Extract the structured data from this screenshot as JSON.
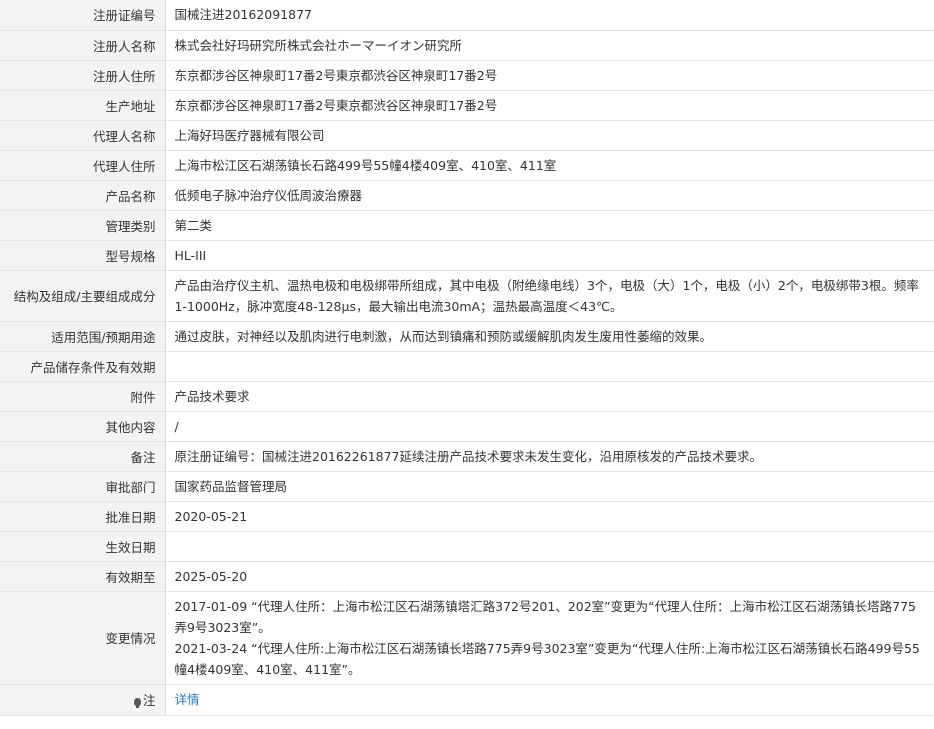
{
  "rows": [
    {
      "label": "注册证编号",
      "value": "国械注进20162091877"
    },
    {
      "label": "注册人名称",
      "value": "株式会社好玛研究所株式会社ホーマーイオン研究所"
    },
    {
      "label": "注册人住所",
      "value": "东京都涉谷区神泉町17番2号東京都渋谷区神泉町17番2号"
    },
    {
      "label": "生产地址",
      "value": "东京都涉谷区神泉町17番2号東京都渋谷区神泉町17番2号"
    },
    {
      "label": "代理人名称",
      "value": "上海好玛医疗器械有限公司"
    },
    {
      "label": "代理人住所",
      "value": "上海市松江区石湖荡镇长石路499号55幢4楼409室、410室、411室"
    },
    {
      "label": "产品名称",
      "value": "低频电子脉冲治疗仪低周波治療器"
    },
    {
      "label": "管理类别",
      "value": "第二类"
    },
    {
      "label": "型号规格",
      "value": "HL-III"
    },
    {
      "label": "结构及组成/主要组成成分",
      "value": "产品由治疗仪主机、温热电极和电极绑带所组成，其中电极（附绝缘电线）3个，电极（大）1个，电极（小）2个，电极绑带3根。频率1-1000Hz，脉冲宽度48-128μs，最大输出电流30mA；温热最高温度＜43℃。"
    },
    {
      "label": "适用范围/预期用途",
      "value": "通过皮肤，对神经以及肌肉进行电刺激，从而达到镇痛和预防或缓解肌肉发生废用性萎缩的效果。"
    },
    {
      "label": "产品储存条件及有效期",
      "value": ""
    },
    {
      "label": "附件",
      "value": "产品技术要求"
    },
    {
      "label": "其他内容",
      "value": "/"
    },
    {
      "label": "备注",
      "value": "原注册证编号：国械注进20162261877延续注册产品技术要求未发生变化，沿用原核发的产品技术要求。"
    },
    {
      "label": "审批部门",
      "value": "国家药品监督管理局"
    },
    {
      "label": "批准日期",
      "value": "2020-05-21"
    },
    {
      "label": "生效日期",
      "value": ""
    },
    {
      "label": "有效期至",
      "value": "2025-05-20"
    }
  ],
  "changes": {
    "label": "变更情况",
    "lines": [
      "2017-01-09 “代理人住所：上海市松江区石湖荡镇塔汇路372号201、202室”变更为“代理人住所：上海市松江区石湖荡镇长塔路775弄9号3023室”。",
      "2021-03-24 “代理人住所:上海市松江区石湖荡镇长塔路775弄9号3023室”变更为“代理人住所:上海市松江区石湖荡镇长石路499号55幢4楼409室、410室、411室”。"
    ]
  },
  "note": {
    "label": "注",
    "icon": "bulb-icon",
    "link": "详情",
    "link_color": "#2a7bbd"
  }
}
